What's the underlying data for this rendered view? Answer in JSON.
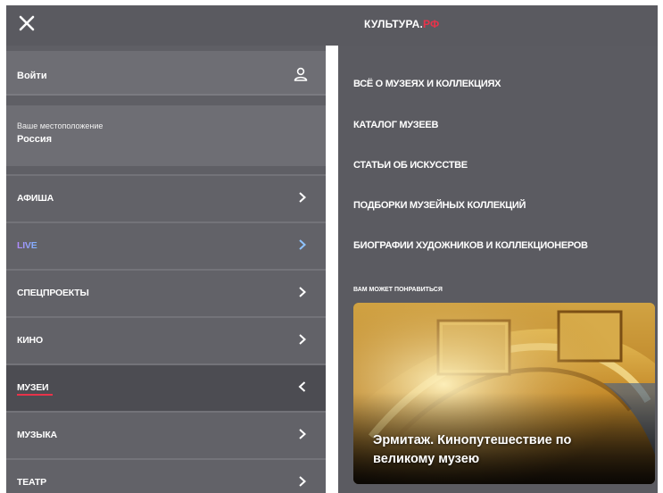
{
  "header": {
    "logo_main": "КУЛЬТУРА.",
    "logo_accent": "РФ"
  },
  "account": {
    "login_label": "Войти"
  },
  "location": {
    "caption": "Ваше местоположение",
    "value": "Россия"
  },
  "menu": {
    "items": [
      {
        "label": "АФИША"
      },
      {
        "label": "LIVE"
      },
      {
        "label": "СПЕЦПРОЕКТЫ"
      },
      {
        "label": "КИНО"
      },
      {
        "label": "МУЗЕИ"
      },
      {
        "label": "МУЗЫКА"
      },
      {
        "label": "ТЕАТР"
      }
    ],
    "active_item": "МУЗЕИ"
  },
  "submenu": {
    "links": [
      "ВСЁ О МУЗЕЯХ И КОЛЛЕКЦИЯХ",
      "КАТАЛОГ МУЗЕЕВ",
      "СТАТЬИ ОБ ИСКУССТВЕ",
      "ПОДБОРКИ МУЗЕЙНЫХ КОЛЛЕКЦИЙ",
      "БИОГРАФИИ ХУДОЖНИКОВ И КОЛЛЕКЦИОНЕРОВ"
    ],
    "suggest_caption": "ВАМ МОЖЕТ ПОНРАВИТЬСЯ",
    "card_title": "Эрмитаж. Кинопутешествие по великому музею"
  },
  "colors": {
    "accent": "#e8334a",
    "panel": "#5b5b61",
    "menu_active": "#4c4c52",
    "live_gradient_start": "#b389ff",
    "live_gradient_end": "#7bb6ff"
  },
  "icons": {
    "close": "close-icon",
    "user": "user-icon",
    "chevron_right": "chevron-right-icon",
    "chevron_left": "chevron-left-icon"
  }
}
